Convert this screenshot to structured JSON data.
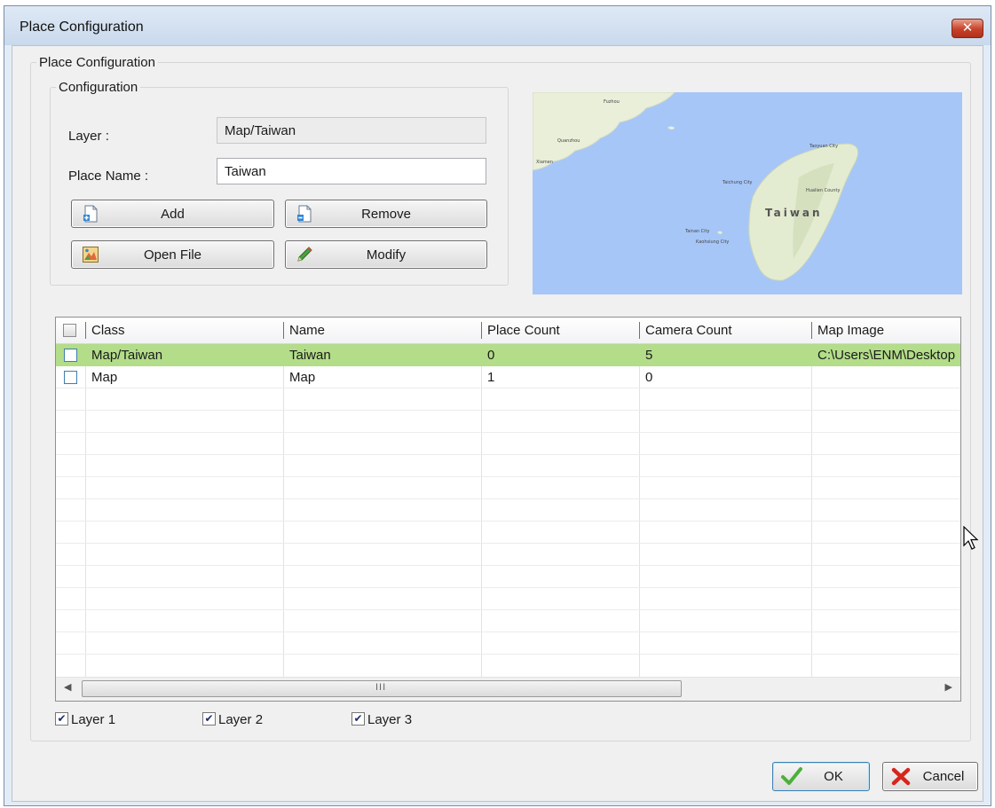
{
  "window": {
    "title": "Place Configuration",
    "close_glyph": "✕"
  },
  "outer_group": {
    "legend": "Place Configuration"
  },
  "config_group": {
    "legend": "Configuration",
    "layer_label": "Layer :",
    "layer_value": "Map/Taiwan",
    "place_name_label": "Place Name :",
    "place_name_value": "Taiwan"
  },
  "buttons": {
    "add": {
      "label": "Add",
      "icon": "add-page-icon"
    },
    "remove": {
      "label": "Remove",
      "icon": "remove-page-icon"
    },
    "open_file": {
      "label": "Open File",
      "icon": "open-image-icon"
    },
    "modify": {
      "label": "Modify",
      "icon": "pencil-icon"
    }
  },
  "map": {
    "island_label": "Taiwan",
    "labels": [
      "Fuzhou",
      "Taoyuan City",
      "Taichung City",
      "Hualien County",
      "Tainan City",
      "Kaohsiung City",
      "Quanzhou",
      "Xiamen"
    ]
  },
  "table": {
    "columns": [
      "Class",
      "Name",
      "Place Count",
      "Camera Count",
      "Map Image"
    ],
    "rows": [
      {
        "class": "Map/Taiwan",
        "name": "Taiwan",
        "place_count": "0",
        "camera_count": "5",
        "map_image": "C:\\Users\\ENM\\Desktop",
        "selected": true
      },
      {
        "class": "Map",
        "name": "Map",
        "place_count": "1",
        "camera_count": "0",
        "map_image": "",
        "selected": false
      }
    ],
    "scroll_grip": "III"
  },
  "layers": [
    {
      "label": "Layer 1",
      "checked": true
    },
    {
      "label": "Layer 2",
      "checked": true
    },
    {
      "label": "Layer 3",
      "checked": true
    }
  ],
  "footer": {
    "ok_label": "OK",
    "cancel_label": "Cancel"
  },
  "colors": {
    "selected_row": "#b3dd89",
    "title_bar": "#c9d9ec",
    "water": "#a6c6f8",
    "land": "#e9efd9",
    "close_button": "#c8412a"
  }
}
